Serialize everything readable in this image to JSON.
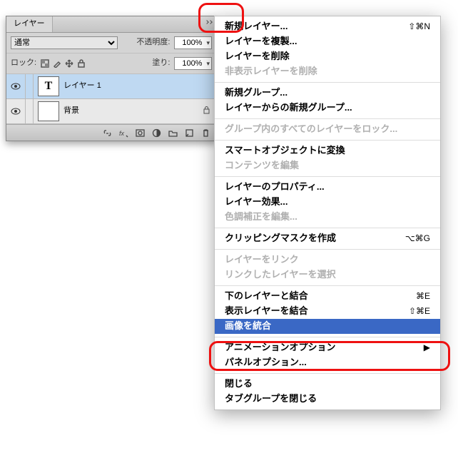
{
  "panel": {
    "tab": "レイヤー",
    "mode": "通常",
    "opacity_label": "不透明度:",
    "opacity_value": "100%",
    "lock_label": "ロック:",
    "fill_label": "塗り:",
    "fill_value": "100%",
    "layers": [
      {
        "name": "レイヤー 1",
        "type": "T",
        "selected": true,
        "locked": false
      },
      {
        "name": "背景",
        "type": "bg",
        "selected": false,
        "locked": true
      }
    ]
  },
  "menu": [
    {
      "label": "新規レイヤー...",
      "shortcut": "⇧⌘N"
    },
    {
      "label": "レイヤーを複製..."
    },
    {
      "label": "レイヤーを削除"
    },
    {
      "label": "非表示レイヤーを削除",
      "disabled": true
    },
    {
      "sep": true
    },
    {
      "label": "新規グループ..."
    },
    {
      "label": "レイヤーからの新規グループ..."
    },
    {
      "sep": true
    },
    {
      "label": "グループ内のすべてのレイヤーをロック...",
      "disabled": true
    },
    {
      "sep": true
    },
    {
      "label": "スマートオブジェクトに変換"
    },
    {
      "label": "コンテンツを編集",
      "disabled": true
    },
    {
      "sep": true
    },
    {
      "label": "レイヤーのプロパティ..."
    },
    {
      "label": "レイヤー効果..."
    },
    {
      "label": "色調補正を編集...",
      "disabled": true
    },
    {
      "sep": true
    },
    {
      "label": "クリッピングマスクを作成",
      "shortcut": "⌥⌘G"
    },
    {
      "sep": true
    },
    {
      "label": "レイヤーをリンク",
      "disabled": true
    },
    {
      "label": "リンクしたレイヤーを選択",
      "disabled": true
    },
    {
      "sep": true
    },
    {
      "label": "下のレイヤーと結合",
      "shortcut": "⌘E"
    },
    {
      "label": "表示レイヤーを結合",
      "shortcut": "⇧⌘E"
    },
    {
      "label": "画像を統合",
      "selected": true
    },
    {
      "sep": true
    },
    {
      "label": "アニメーションオプション",
      "submenu": true
    },
    {
      "label": "パネルオプション..."
    },
    {
      "sep": true
    },
    {
      "label": "閉じる"
    },
    {
      "label": "タブグループを閉じる"
    }
  ]
}
